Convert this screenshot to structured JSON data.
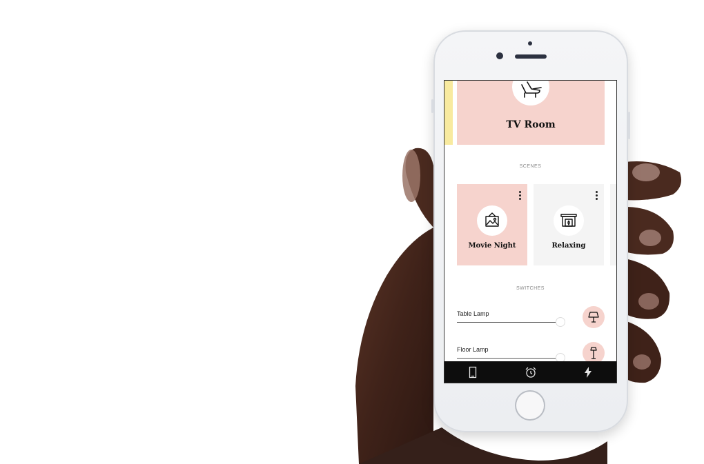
{
  "room": {
    "title": "TV Room",
    "icon": "recliner-chair-icon"
  },
  "sections": {
    "scenes": "SCENES",
    "switches": "SWITCHES"
  },
  "scenes": [
    {
      "name": "Movie Night",
      "icon": "picture-frame-icon",
      "active": true
    },
    {
      "name": "Relaxing",
      "icon": "fireplace-icon",
      "active": false
    }
  ],
  "switches": [
    {
      "name": "Table Lamp",
      "icon": "table-lamp-icon",
      "level": 0.95
    },
    {
      "name": "Floor Lamp",
      "icon": "floor-lamp-icon",
      "level": 0.95
    }
  ],
  "tabs": [
    {
      "icon": "door-icon"
    },
    {
      "icon": "alarm-clock-icon"
    },
    {
      "icon": "lightning-icon"
    }
  ],
  "colors": {
    "accent_pink": "#f6d3cd",
    "accent_yellow": "#f8ea9f",
    "tabbar": "#0d0d0d",
    "card_grey": "#f4f4f4"
  }
}
